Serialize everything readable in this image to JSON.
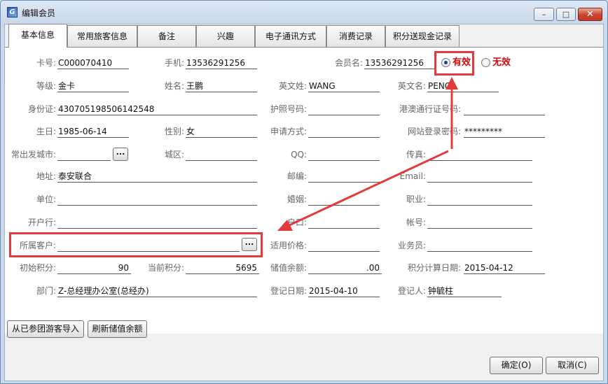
{
  "window": {
    "title": "编辑会员",
    "min_icon": "minimize-icon",
    "max_icon": "maximize-icon",
    "close_icon": "close-icon"
  },
  "tabs": [
    {
      "label": "基本信息",
      "active": true
    },
    {
      "label": "常用旅客信息"
    },
    {
      "label": "备注"
    },
    {
      "label": "兴趣"
    },
    {
      "label": "电子通讯方式"
    },
    {
      "label": "消费记录"
    },
    {
      "label": "积分送现金记录"
    }
  ],
  "form": {
    "card_no": {
      "label": "卡号:",
      "value": "C000070410"
    },
    "mobile": {
      "label": "手机:",
      "value": "13536291256"
    },
    "member_name": {
      "label": "会员名:",
      "value": "13536291256"
    },
    "status_valid": {
      "label": "有效",
      "selected": true
    },
    "status_invalid": {
      "label": "无效",
      "selected": false
    },
    "level": {
      "label": "等级:",
      "value": "金卡"
    },
    "name": {
      "label": "姓名:",
      "value": "王鹏"
    },
    "en_surname": {
      "label": "英文姓:",
      "value": "WANG"
    },
    "en_name": {
      "label": "英文名:",
      "value": "PENG"
    },
    "id_card": {
      "label": "身份证:",
      "value": "430705198506142548"
    },
    "passport": {
      "label": "护照号码:",
      "value": ""
    },
    "hk_macau_pass": {
      "label": "港澳通行证号码:",
      "value": ""
    },
    "birthday": {
      "label": "生日:",
      "value": "1985-06-14"
    },
    "gender": {
      "label": "性别:",
      "value": "女"
    },
    "apply_method": {
      "label": "申请方式:",
      "value": ""
    },
    "web_password": {
      "label": "网站登录密码:",
      "value": "*********"
    },
    "dep_city": {
      "label": "常出发城市:",
      "value": ""
    },
    "district": {
      "label": "城区:",
      "value": ""
    },
    "qq": {
      "label": "QQ:",
      "value": ""
    },
    "fax": {
      "label": "传真:",
      "value": ""
    },
    "address": {
      "label": "地址:",
      "value": "泰安联合"
    },
    "postcode": {
      "label": "邮编:",
      "value": ""
    },
    "email": {
      "label": "Email:",
      "value": ""
    },
    "company": {
      "label": "单位:",
      "value": ""
    },
    "marriage": {
      "label": "婚姻:",
      "value": ""
    },
    "occupation": {
      "label": "职业:",
      "value": ""
    },
    "bank": {
      "label": "开户行:",
      "value": ""
    },
    "hukou": {
      "label": "户口:",
      "value": ""
    },
    "account": {
      "label": "帐号:",
      "value": ""
    },
    "client": {
      "label": "所属客户:",
      "value": ""
    },
    "price": {
      "label": "适用价格:",
      "value": ""
    },
    "salesman": {
      "label": "业务员:",
      "value": ""
    },
    "init_points": {
      "label": "初始积分:",
      "value": "90"
    },
    "cur_points": {
      "label": "当前积分:",
      "value": "5695"
    },
    "balance": {
      "label": "储值余额:",
      "value": ".00"
    },
    "points_date": {
      "label": "积分计算日期:",
      "value": "2015-04-12"
    },
    "department": {
      "label": "部门:",
      "value": "Z-总经理办公室(总经办)"
    },
    "reg_date": {
      "label": "登记日期:",
      "value": "2015-04-10"
    },
    "registrar": {
      "label": "登记人:",
      "value": "钟毓柱"
    },
    "browse_label": "..."
  },
  "buttons": {
    "import": "从已参团游客导入",
    "refresh": "刷新储值余额",
    "ok": "确定(O)",
    "cancel": "取消(C)"
  },
  "colors": {
    "highlight": "#e23b3b",
    "status_text": "#d20a0a"
  }
}
